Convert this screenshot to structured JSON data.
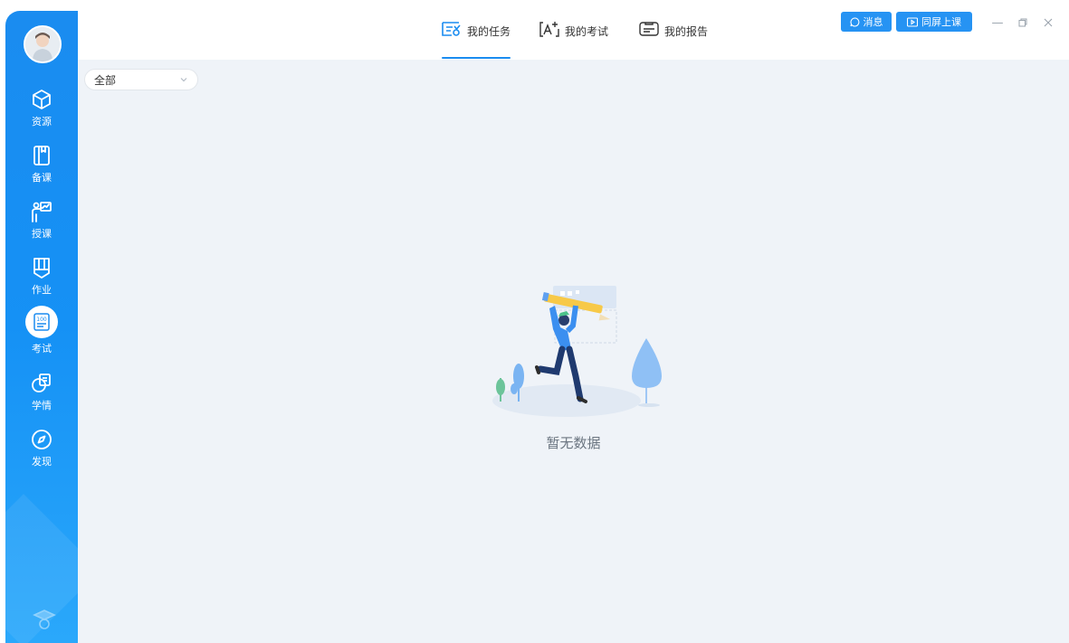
{
  "sidebar": {
    "items": [
      {
        "label": "资源",
        "icon": "cube-icon"
      },
      {
        "label": "备课",
        "icon": "book-icon"
      },
      {
        "label": "授课",
        "icon": "teacher-board-icon"
      },
      {
        "label": "作业",
        "icon": "homework-bookmark-icon"
      },
      {
        "label": "考试",
        "icon": "exam-paper-icon",
        "active": true
      },
      {
        "label": "学情",
        "icon": "learning-analytics-icon"
      },
      {
        "label": "发现",
        "icon": "compass-icon"
      }
    ]
  },
  "header": {
    "tabs": [
      {
        "label": "我的任务",
        "icon": "task-list-icon",
        "active": true
      },
      {
        "label": "我的考试",
        "icon": "exam-add-icon",
        "active": false
      },
      {
        "label": "我的报告",
        "icon": "report-icon",
        "active": false
      }
    ],
    "messages_label": "消息",
    "sync_class_label": "同屏上课"
  },
  "main": {
    "filter": {
      "selected": "全部"
    },
    "empty_text": "暂无数据"
  },
  "colors": {
    "primary": "#1a8cf0",
    "background": "#eff3f8"
  }
}
